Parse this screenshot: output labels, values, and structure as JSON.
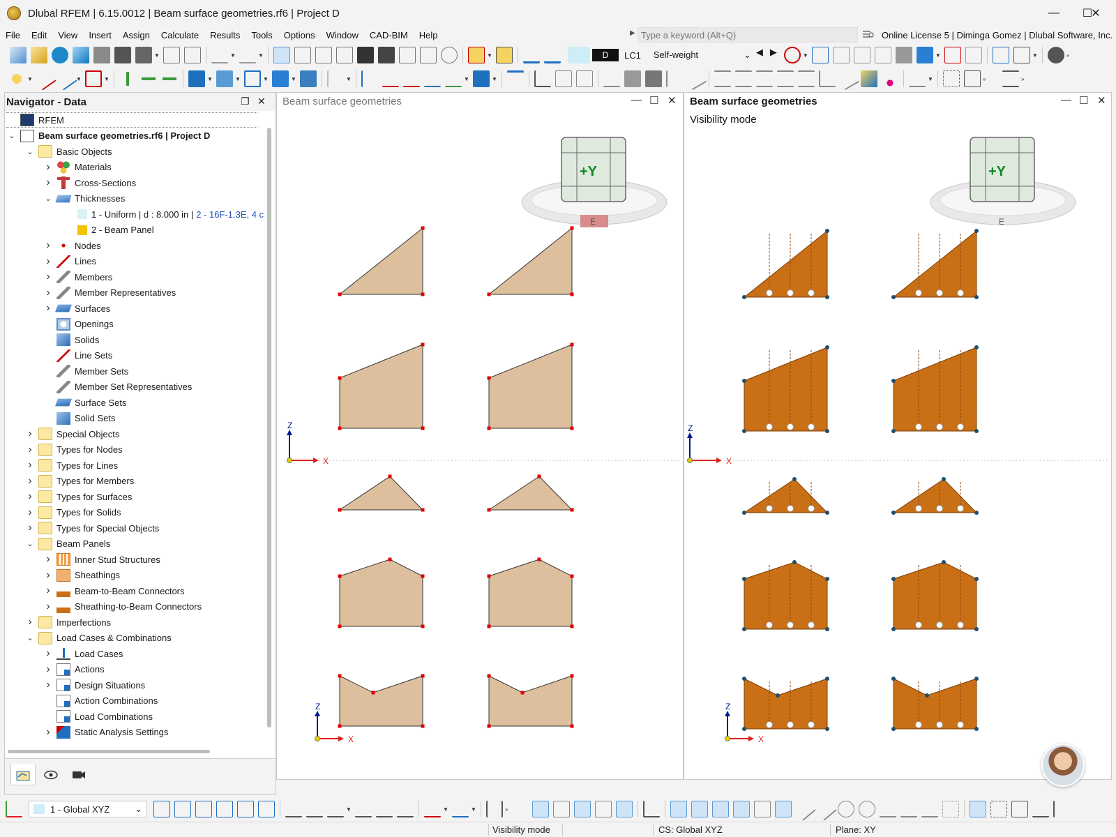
{
  "window": {
    "title": "Dlubal RFEM | 6.15.0012 | Beam surface geometries.rf6 | Project D",
    "controls": {
      "minimize": "—",
      "maximize": "☐",
      "close": "✕"
    }
  },
  "menu": [
    "File",
    "Edit",
    "View",
    "Insert",
    "Assign",
    "Calculate",
    "Results",
    "Tools",
    "Options",
    "Window",
    "CAD-BIM",
    "Help"
  ],
  "search": {
    "placeholder": "Type a keyword (Alt+Q)"
  },
  "license": "Online License 5 | Diminga Gomez | Dlubal Software, Inc.",
  "loadcase": {
    "tag": "D",
    "name": "LC1",
    "desc": "Self-weight"
  },
  "navigator": {
    "title": "Navigator - Data",
    "tree": [
      {
        "label": "RFEM",
        "level": 0,
        "chev": "",
        "icon": "rfem"
      },
      {
        "label": "Beam surface geometries.rf6 | Project D",
        "level": 0,
        "chev": "v",
        "icon": "model",
        "bold": true
      },
      {
        "label": "Basic Objects",
        "level": 1,
        "chev": "v",
        "icon": "folder"
      },
      {
        "label": "Materials",
        "level": 2,
        "chev": ">",
        "icon": "materials"
      },
      {
        "label": "Cross-Sections",
        "level": 2,
        "chev": ">",
        "icon": "section"
      },
      {
        "label": "Thicknesses",
        "level": 2,
        "chev": "v",
        "icon": "thickness"
      },
      {
        "label": "1 - Uniform | d : 8.000 in |",
        "label2": "2 - 16F-1.3E, 4 c",
        "level": 3,
        "chev": "",
        "icon": "swatch-cyan"
      },
      {
        "label": "2 - Beam Panel",
        "level": 3,
        "chev": "",
        "icon": "swatch-yellow"
      },
      {
        "label": "Nodes",
        "level": 2,
        "chev": ">",
        "icon": "node"
      },
      {
        "label": "Lines",
        "level": 2,
        "chev": ">",
        "icon": "line"
      },
      {
        "label": "Members",
        "level": 2,
        "chev": ">",
        "icon": "member"
      },
      {
        "label": "Member Representatives",
        "level": 2,
        "chev": ">",
        "icon": "member"
      },
      {
        "label": "Surfaces",
        "level": 2,
        "chev": ">",
        "icon": "surface"
      },
      {
        "label": "Openings",
        "level": 2,
        "chev": "",
        "icon": "opening"
      },
      {
        "label": "Solids",
        "level": 2,
        "chev": "",
        "icon": "solid"
      },
      {
        "label": "Line Sets",
        "level": 2,
        "chev": "",
        "icon": "line"
      },
      {
        "label": "Member Sets",
        "level": 2,
        "chev": "",
        "icon": "member"
      },
      {
        "label": "Member Set Representatives",
        "level": 2,
        "chev": "",
        "icon": "member"
      },
      {
        "label": "Surface Sets",
        "level": 2,
        "chev": "",
        "icon": "surface"
      },
      {
        "label": "Solid Sets",
        "level": 2,
        "chev": "",
        "icon": "solid"
      },
      {
        "label": "Special Objects",
        "level": 1,
        "chev": ">",
        "icon": "folder"
      },
      {
        "label": "Types for Nodes",
        "level": 1,
        "chev": ">",
        "icon": "folder"
      },
      {
        "label": "Types for Lines",
        "level": 1,
        "chev": ">",
        "icon": "folder"
      },
      {
        "label": "Types for Members",
        "level": 1,
        "chev": ">",
        "icon": "folder"
      },
      {
        "label": "Types for Surfaces",
        "level": 1,
        "chev": ">",
        "icon": "folder"
      },
      {
        "label": "Types for Solids",
        "level": 1,
        "chev": ">",
        "icon": "folder"
      },
      {
        "label": "Types for Special Objects",
        "level": 1,
        "chev": ">",
        "icon": "folder"
      },
      {
        "label": "Beam Panels",
        "level": 1,
        "chev": "v",
        "icon": "folder"
      },
      {
        "label": "Inner Stud Structures",
        "level": 2,
        "chev": ">",
        "icon": "studs"
      },
      {
        "label": "Sheathings",
        "level": 2,
        "chev": ">",
        "icon": "sheathing"
      },
      {
        "label": "Beam-to-Beam Connectors",
        "level": 2,
        "chev": ">",
        "icon": "connector"
      },
      {
        "label": "Sheathing-to-Beam Connectors",
        "level": 2,
        "chev": ">",
        "icon": "connector"
      },
      {
        "label": "Imperfections",
        "level": 1,
        "chev": ">",
        "icon": "folder"
      },
      {
        "label": "Load Cases & Combinations",
        "level": 1,
        "chev": "v",
        "icon": "folder"
      },
      {
        "label": "Load Cases",
        "level": 2,
        "chev": ">",
        "icon": "loadcase"
      },
      {
        "label": "Actions",
        "level": 2,
        "chev": ">",
        "icon": "action"
      },
      {
        "label": "Design Situations",
        "level": 2,
        "chev": ">",
        "icon": "action"
      },
      {
        "label": "Action Combinations",
        "level": 2,
        "chev": "",
        "icon": "action"
      },
      {
        "label": "Load Combinations",
        "level": 2,
        "chev": "",
        "icon": "action"
      },
      {
        "label": "Static Analysis Settings",
        "level": 2,
        "chev": ">",
        "icon": "settings"
      }
    ]
  },
  "views": {
    "left": {
      "title": "Beam surface geometries",
      "cube_label": "+Y",
      "ring_label": "E"
    },
    "right": {
      "title": "Beam surface geometries",
      "mode": "Visibility mode",
      "cube_label": "+Y",
      "ring_label": "E"
    },
    "axes": {
      "x": "X",
      "z": "Z"
    }
  },
  "bottom": {
    "coord_system": "1 - Global XYZ"
  },
  "status": {
    "mode": "Visibility mode",
    "cs": "CS: Global XYZ",
    "plane": "Plane: XY"
  },
  "colors": {
    "accent": "#0063b1",
    "surface_fill": "#ddbf9d",
    "panel_fill": "#c96f16",
    "node": "#e00000"
  }
}
